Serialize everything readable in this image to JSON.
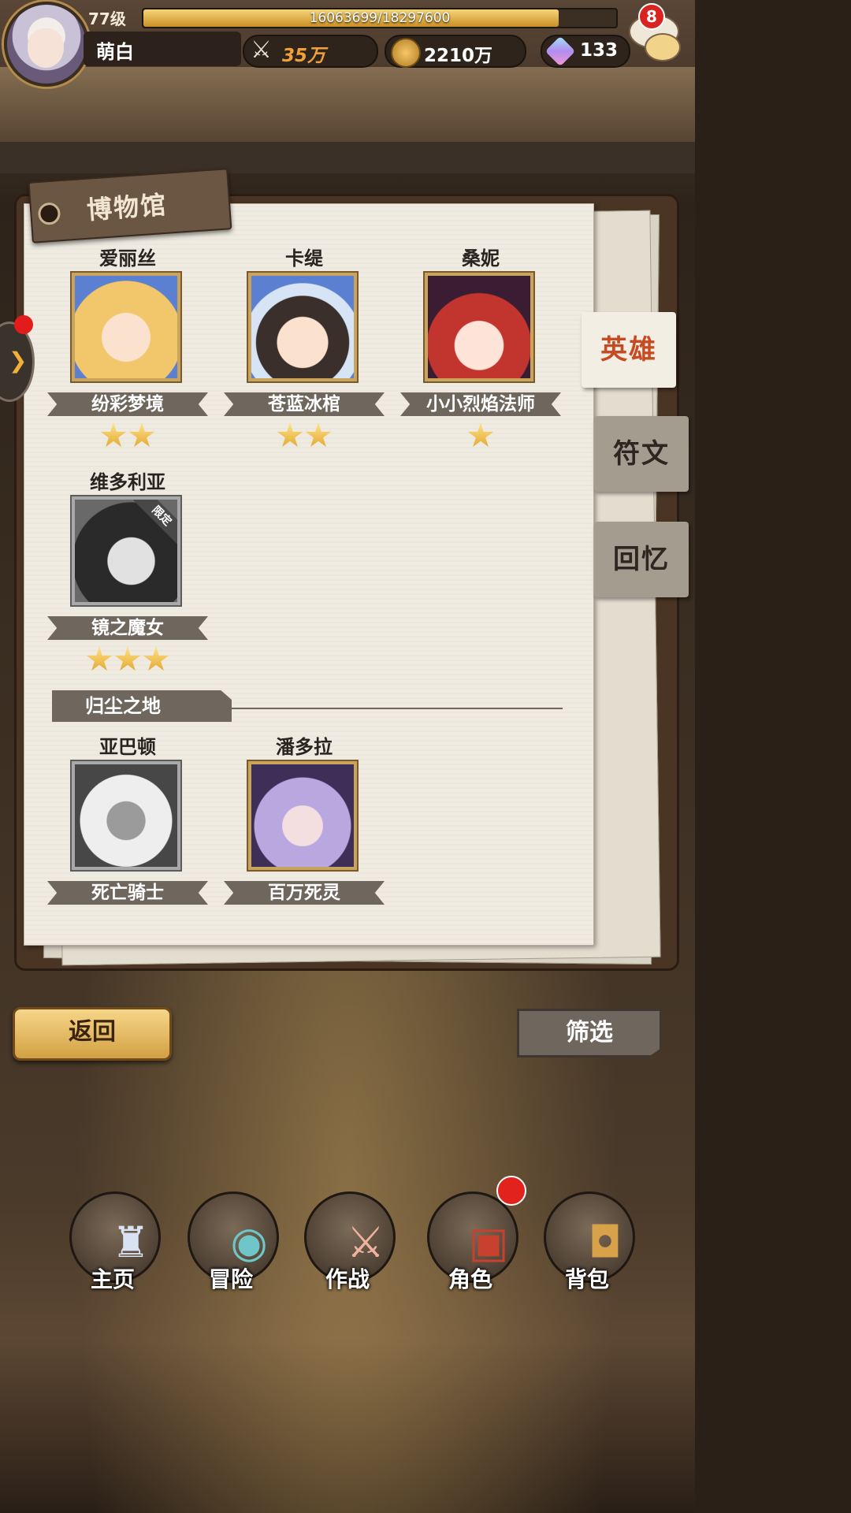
{
  "header": {
    "level": "77级",
    "xp_text": "16063699/18297600",
    "xp_progress": 0.878,
    "player_name": "萌白",
    "power": "35万",
    "gold": "2210万",
    "gems": "133",
    "chat_badge": "8",
    "icons": [
      "sword-icon",
      "coin-icon",
      "gem-icon",
      "chat-icon"
    ]
  },
  "museum": {
    "title": "博物馆",
    "tabs": [
      {
        "label": "英雄",
        "active": true
      },
      {
        "label": "符文",
        "active": false
      },
      {
        "label": "回忆",
        "active": false
      }
    ],
    "heroes": [
      {
        "name": "爱丽丝",
        "title": "纷彩梦境",
        "stars": 2,
        "greyed": false,
        "limited": false,
        "tone": "#f2c66a"
      },
      {
        "name": "卡缇",
        "title": "苍蓝冰棺",
        "stars": 2,
        "greyed": false,
        "limited": false,
        "tone": "#5b7fd1"
      },
      {
        "name": "桑妮",
        "title": "小小烈焰法师",
        "stars": 1,
        "greyed": false,
        "limited": false,
        "tone": "#c2342e"
      },
      {
        "name": "维多利亚",
        "title": "镜之魔女",
        "stars": 3,
        "greyed": true,
        "limited": true,
        "limited_label": "限定",
        "tone": "#555555"
      }
    ],
    "section_label": "归尘之地",
    "fallen": [
      {
        "name": "亚巴顿",
        "title": "死亡骑士",
        "greyed": true,
        "tone": "#777777"
      },
      {
        "name": "潘多拉",
        "title": "百万死灵",
        "greyed": false,
        "tone": "#8c76c7"
      }
    ]
  },
  "buttons": {
    "back": "返回",
    "filter": "筛选"
  },
  "nav": [
    {
      "label": "主页",
      "icon": "castle-icon",
      "alert": false
    },
    {
      "label": "冒险",
      "icon": "portal-icon",
      "alert": false
    },
    {
      "label": "作战",
      "icon": "battle-icon",
      "alert": false
    },
    {
      "label": "角色",
      "icon": "book-icon",
      "alert": true
    },
    {
      "label": "背包",
      "icon": "bag-icon",
      "alert": false
    }
  ]
}
